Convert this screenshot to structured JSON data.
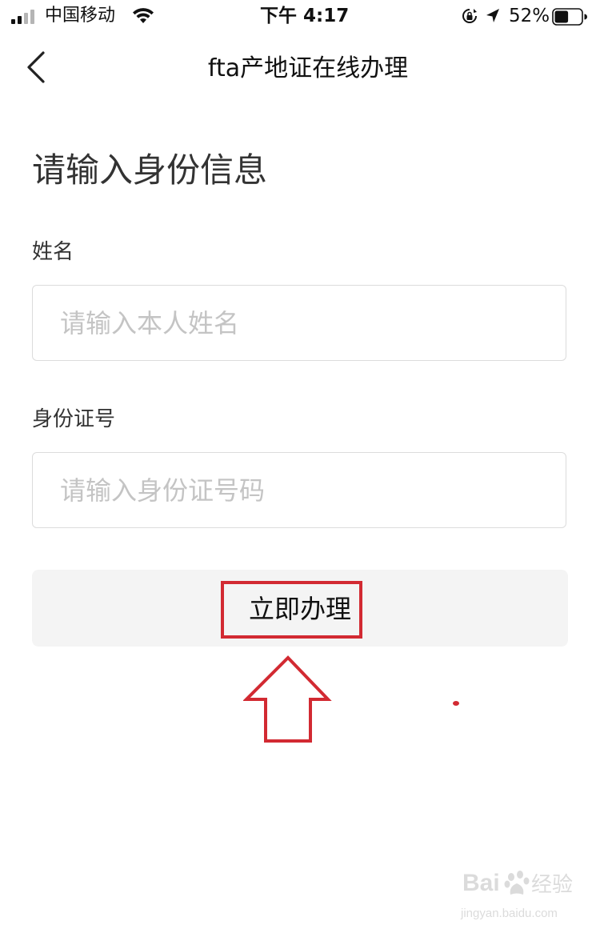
{
  "status_bar": {
    "carrier": "中国移动",
    "time": "下午 4:17",
    "battery_percent": "52%",
    "battery_level": 0.52
  },
  "nav": {
    "title": "fta产地证在线办理"
  },
  "form": {
    "heading": "请输入身份信息",
    "name_label": "姓名",
    "name_placeholder": "请输入本人姓名",
    "name_value": "",
    "id_label": "身份证号",
    "id_placeholder": "请输入身份证号码",
    "id_value": "",
    "submit_label": "立即办理"
  },
  "watermark": {
    "brand": "Bai",
    "product": "经验",
    "url": "jingyan.baidu.com"
  },
  "colors": {
    "annotation": "#d22a32",
    "button_bg": "#f4f4f4",
    "placeholder": "#c4c4c4"
  },
  "icons": [
    "signal-icon",
    "wifi-icon",
    "rotation-lock-icon",
    "location-arrow-icon",
    "battery-icon",
    "back-chevron-icon",
    "up-arrow-annotation-icon",
    "baidu-paw-icon"
  ]
}
